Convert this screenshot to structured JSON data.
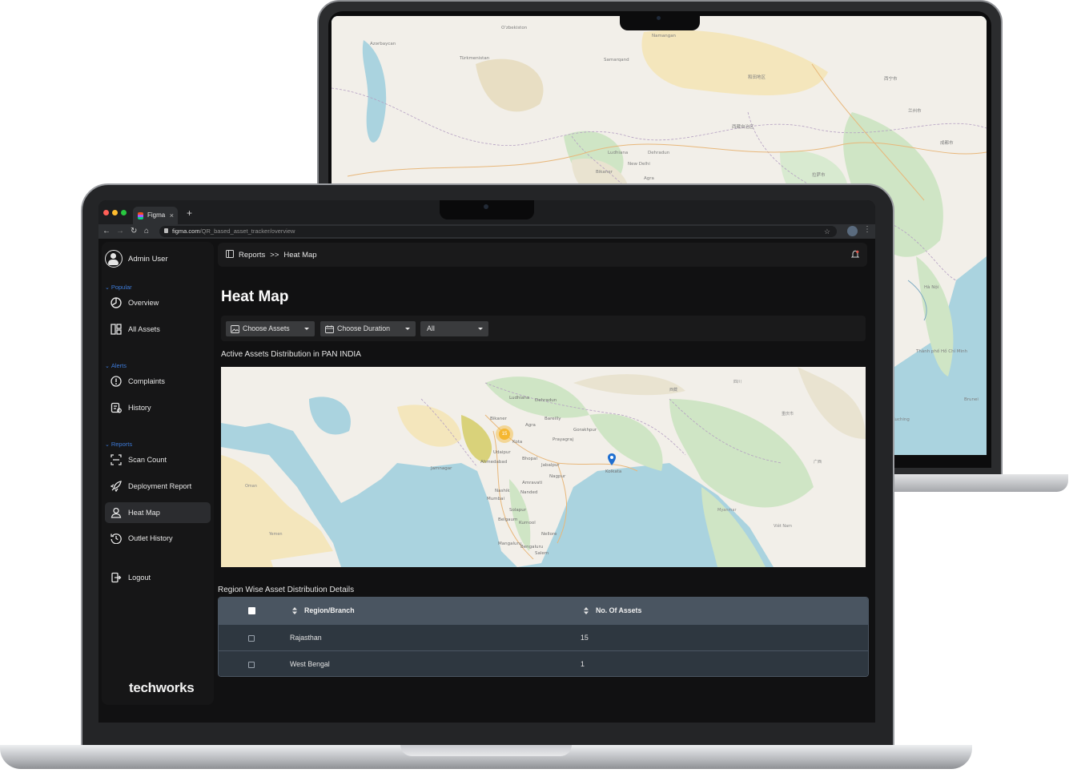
{
  "browser": {
    "tab_title": "Figma",
    "tab_close": "×",
    "new_tab": "+",
    "url_host": "figma.com",
    "url_path": "/QR_based_asset_tracker/overview"
  },
  "sidebar": {
    "user_name": "Admin User",
    "sections": {
      "popular": "Popular",
      "alerts": "Alerts",
      "reports": "Reports"
    },
    "items": [
      {
        "label": "Overview",
        "icon": "pie-chart-icon"
      },
      {
        "label": "All Assets",
        "icon": "grid-icon"
      },
      {
        "label": "Complaints",
        "icon": "alert-circle-icon"
      },
      {
        "label": "History",
        "icon": "history-list-icon"
      },
      {
        "label": "Scan Count",
        "icon": "scan-icon"
      },
      {
        "label": "Deployment Report",
        "icon": "rocket-icon"
      },
      {
        "label": "Heat Map",
        "icon": "user-location-icon"
      },
      {
        "label": "Outlet History",
        "icon": "clock-history-icon"
      },
      {
        "label": "Logout",
        "icon": "logout-icon"
      }
    ],
    "active_item": "Heat Map",
    "brand": "techworks"
  },
  "header": {
    "breadcrumb_root": "Reports",
    "breadcrumb_sep": ">>",
    "breadcrumb_current": "Heat Map"
  },
  "page": {
    "title": "Heat Map",
    "filters": {
      "assets": "Choose Assets",
      "duration": "Choose Duration",
      "scope": "All"
    },
    "map_title": "Active Assets Distribution in PAN INDIA",
    "map_markers": [
      {
        "label": "15",
        "type": "cluster",
        "color": "#f5b731"
      },
      {
        "label": "",
        "type": "pin",
        "color": "#1f6fd1"
      }
    ],
    "map_places": [
      "Ludhiana",
      "Dehradun",
      "Bareilly",
      "Bikaner",
      "Agra",
      "Kota",
      "Ahmedabad",
      "Udaipur",
      "Bhopal",
      "Jabalpur",
      "Nagpur",
      "Nashik",
      "Mumbai",
      "Amravati",
      "Nanded",
      "Solapur",
      "Belgaum",
      "Kurnool",
      "Nellore",
      "Bengaluru",
      "Salem",
      "Mangaluru",
      "Prayagraj",
      "Gorakhpur",
      "Kolkata",
      "Jamnagar"
    ],
    "table_title": "Region Wise Asset Distribution Details",
    "table": {
      "columns": [
        "Region/Branch",
        "No. Of Assets"
      ],
      "rows": [
        {
          "region": "Rajasthan",
          "count": "15"
        },
        {
          "region": "West Bengal",
          "count": "1"
        }
      ]
    }
  },
  "colors": {
    "accent": "#3d7bd9",
    "table_header": "#4a5561",
    "table_row": "#2e3740",
    "sea": "#aad3df",
    "land": "#f2efe9"
  }
}
